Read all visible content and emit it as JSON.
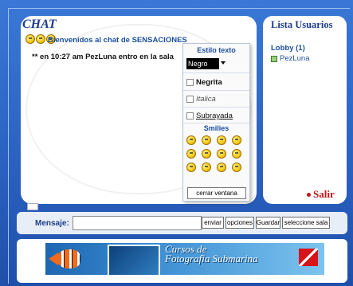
{
  "chat": {
    "title": "CHAT",
    "welcome": "Bienvenidos al chat de SENSACIONES",
    "message": "** en 10:27 am PezLuna entro en la sala"
  },
  "users": {
    "title": "Lista Usuarios",
    "room": "Lobby (1)",
    "items": [
      {
        "name": "PezLuna"
      }
    ]
  },
  "salir": "Salir",
  "style_box": {
    "title": "Estilo texto",
    "color_value": "Negro",
    "options": [
      "Negrita",
      "Italica",
      "Subrayada"
    ],
    "smilies_title": "Smilies",
    "close_label": "cerrar ventana"
  },
  "input": {
    "label": "Mensaje:",
    "value": "",
    "buttons": [
      "enviar",
      "opciones",
      "Guardar",
      "seleccione sala"
    ]
  },
  "banner": {
    "text_line1": "Cursos de",
    "text_line2": "Fotografia Submarina"
  }
}
